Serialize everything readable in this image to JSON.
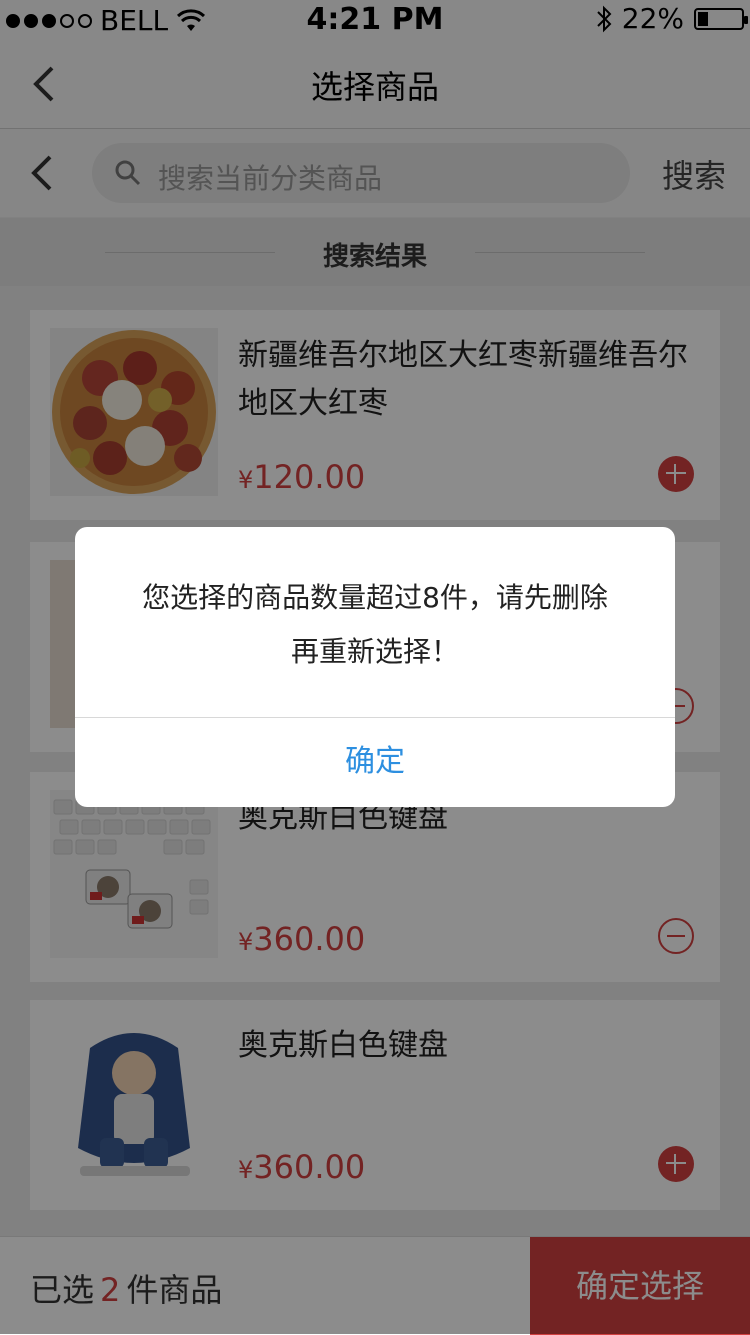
{
  "status_bar": {
    "carrier": "BELL",
    "time": "4:21 PM",
    "battery": "22%"
  },
  "nav": {
    "title": "选择商品"
  },
  "search": {
    "placeholder": "搜索当前分类商品",
    "button": "搜索"
  },
  "section": {
    "title": "搜索结果"
  },
  "products": [
    {
      "name": "新疆维吾尔地区大红枣新疆维吾尔地区大红枣",
      "currency": "¥",
      "price": "120.00",
      "action": "add"
    },
    {
      "name": "",
      "currency": "¥",
      "price": "",
      "action": "remove"
    },
    {
      "name": "奥克斯白色键盘",
      "currency": "¥",
      "price": "360.00",
      "action": "remove"
    },
    {
      "name": "奥克斯白色键盘",
      "currency": "¥",
      "price": "360.00",
      "action": "add"
    }
  ],
  "bottom": {
    "prefix": "已选",
    "count": "2",
    "suffix": "件商品",
    "confirm": "确定选择"
  },
  "dialog": {
    "message": "您选择的商品数量超过8件，请先删除再重新选择！",
    "ok": "确定"
  },
  "colors": {
    "accent": "#d14040",
    "link": "#2d8fe0"
  }
}
